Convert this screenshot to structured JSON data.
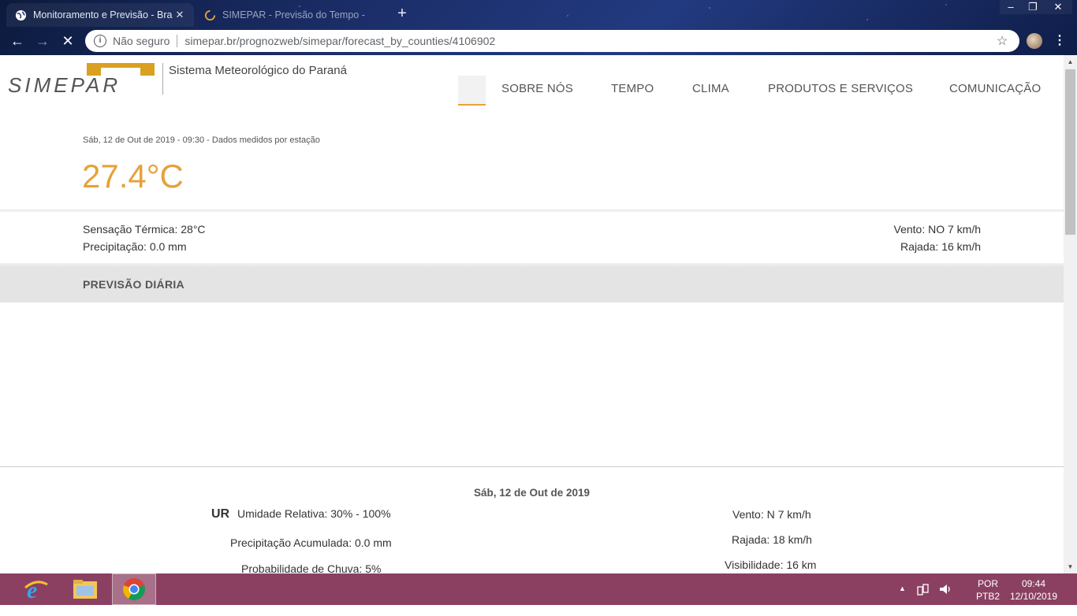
{
  "browser": {
    "tabs": [
      {
        "title": "Monitoramento e Previsão - Bra",
        "icon": "globe-icon"
      },
      {
        "title": "SIMEPAR - Previsão do Tempo - ",
        "icon": "loading-icon"
      }
    ],
    "security_label": "Não seguro",
    "url": "simepar.br/prognozweb/simepar/forecast_by_counties/4106902"
  },
  "site": {
    "logo_text": "SIMEPAR",
    "tagline": "Sistema Meteorológico do Paraná",
    "nav": [
      "SOBRE NÓS",
      "TEMPO",
      "CLIMA",
      "PRODUTOS E SERVIÇOS",
      "COMUNICAÇÃO"
    ],
    "accent_color": "#e5a23c"
  },
  "current": {
    "timestamp": "Sáb, 12 de Out de 2019 - 09:30 - Dados medidos por estação",
    "temperature": "27.4°C",
    "feels_like": "Sensação Térmica: 28°C",
    "precipitation": "Precipitação: 0.0 mm",
    "wind": "Vento: NO 7 km/h",
    "gust": "Rajada: 16 km/h"
  },
  "daily": {
    "section_title": "PREVISÃO DIÁRIA",
    "date": "Sáb, 12 de Out de 2019",
    "ur_tag": "UR",
    "humidity": "Umidade Relativa: 30% - 100%",
    "precip_acc": "Precipitação Acumulada: 0.0 mm",
    "rain_prob": "Probabilidade de Chuva: 5%",
    "wind": "Vento: N 7 km/h",
    "gust": "Rajada: 18 km/h",
    "visibility": "Visibilidade: 16 km"
  },
  "taskbar": {
    "lang_top": "POR",
    "lang_bottom": "PTB2",
    "time": "09:44",
    "date": "12/10/2019"
  }
}
